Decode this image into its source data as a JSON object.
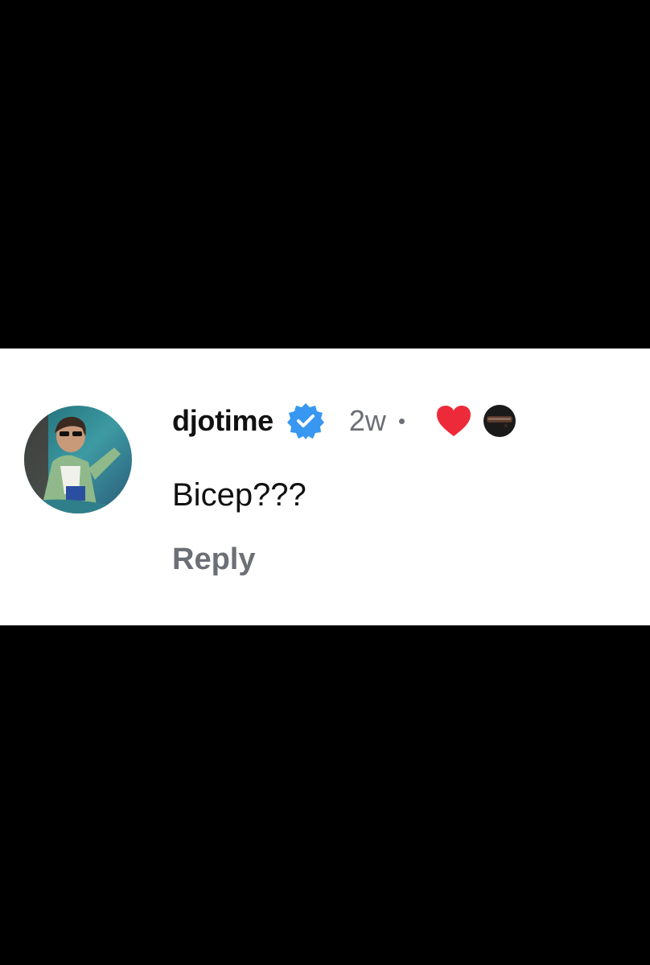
{
  "comment": {
    "username": "djotime",
    "verified": true,
    "timestamp": "2w",
    "liked_by_creator": true,
    "text": "Bicep???",
    "reply_label": "Reply"
  },
  "icons": {
    "verified": "verified-badge-icon",
    "like": "heart-icon"
  },
  "colors": {
    "verified_blue": "#3897f0",
    "heart_red": "#ed2a3a",
    "secondary_text": "#6b6f76",
    "primary_text": "#111111"
  }
}
